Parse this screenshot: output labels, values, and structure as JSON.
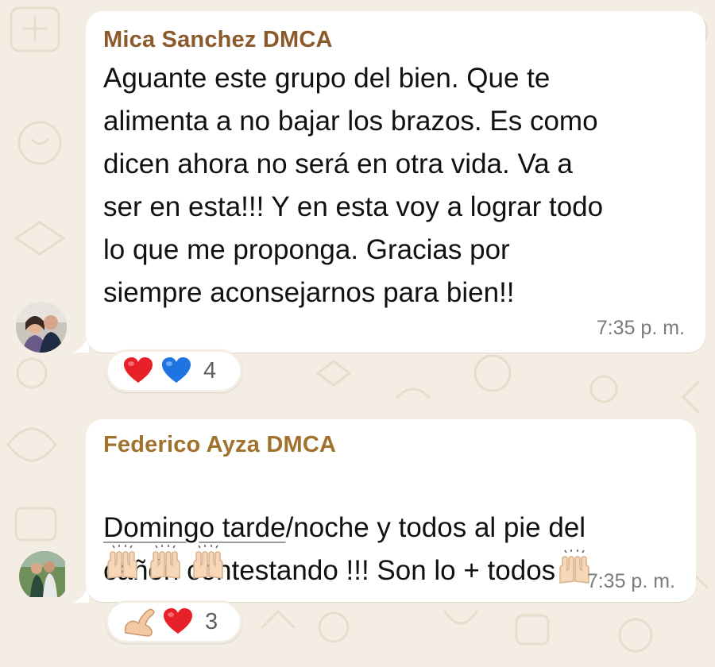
{
  "theme": {
    "background": "#f3ede3",
    "bubble": "#ffffff",
    "sender_color_1": "#8b5a2b",
    "sender_color_2": "#a0722c"
  },
  "messages": [
    {
      "sender": "Mica Sanchez DMCA",
      "text": "Aguante este grupo del bien. Que te\nalimenta a no bajar los brazos. Es como\ndicen ahora no será en otra vida. Va a\nser en esta!!! Y en esta voy a lograr todo\nlo que me proponga. Gracias por\nsiempre aconsejarnos para bien!!",
      "time": "7:35 p. m.",
      "reactions": {
        "emojis": [
          "red-heart",
          "blue-heart"
        ],
        "count": "4"
      },
      "avatar": "avatar-photo"
    },
    {
      "sender": "Federico Ayza DMCA",
      "text_link": "Domingo tarde",
      "text_rest": "/noche y todos al pie del\ncañón contestando !!! Son lo + todos",
      "trailing_emojis": [
        "raising-hands",
        "raising-hands",
        "raising-hands",
        "raising-hands"
      ],
      "time": "7:35 p. m.",
      "reactions": {
        "emojis": [
          "flexed-biceps",
          "red-heart"
        ],
        "count": "3"
      },
      "avatar": "avatar-photo"
    }
  ]
}
